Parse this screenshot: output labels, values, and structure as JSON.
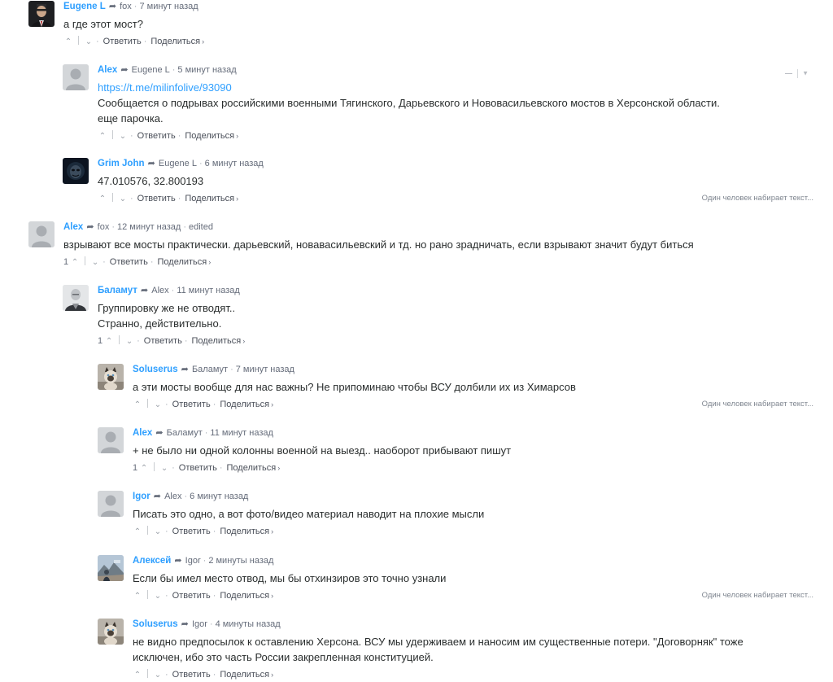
{
  "ui": {
    "reply_label": "Ответить",
    "share_label": "Поделиться",
    "share_chevron": "›",
    "typing_indicator": "Один человек набирает текст...",
    "edited_label": "edited"
  },
  "colors": {
    "link": "#2e9fff",
    "text": "#2a2e2e",
    "meta": "#656c7a"
  },
  "comments": [
    {
      "author": "Eugene L",
      "parent": "fox",
      "time": "7 минут назад",
      "text": "а где этот мост?",
      "votes": "",
      "avatar": "portrait-icon"
    },
    {
      "author": "Alex",
      "parent": "Eugene L",
      "time": "5 минут назад",
      "link": "https://t.me/milinfolive/93090",
      "text": "Сообщается о подрывах российскими военными Тягинского, Дарьевского и Нововасильевского мостов в Херсонской области.\nеще парочка.",
      "votes": "",
      "avatar": "default-avatar-icon"
    },
    {
      "author": "Grim John",
      "parent": "Eugene L",
      "time": "6 минут назад",
      "text": "47.010576, 32.800193",
      "votes": "",
      "avatar": "dark-mask-icon"
    },
    {
      "author": "Alex",
      "parent": "fox",
      "time": "12 минут назад",
      "edited": true,
      "text": "взрывают все мосты практически. дарьевский, новавасильевский и тд. но рано зрадничать, если взрывают значит будут биться",
      "votes": "1",
      "avatar": "default-avatar-icon"
    },
    {
      "author": "Баламут",
      "parent": "Alex",
      "time": "11 минут назад",
      "text": "Группировку же не отводят..\nСтранно, действительно.",
      "votes": "1",
      "avatar": "bald-man-icon"
    },
    {
      "author": "Soluserus",
      "parent": "Баламут",
      "time": "7 минут назад",
      "text": "а эти мосты вообще для нас важны? Не припоминаю чтобы ВСУ долбили их из Химарсов",
      "votes": "",
      "avatar": "cat-icon"
    },
    {
      "author": "Alex",
      "parent": "Баламут",
      "time": "11 минут назад",
      "text": "+ не было ни одной колонны военной на выезд.. наоборот прибывают пишут",
      "votes": "1",
      "avatar": "default-avatar-icon"
    },
    {
      "author": "Igor",
      "parent": "Alex",
      "time": "6 минут назад",
      "text": "Писать это одно, а вот фото/видео материал наводит на плохие мысли",
      "votes": "",
      "avatar": "default-avatar-icon"
    },
    {
      "author": "Алексей",
      "parent": "Igor",
      "time": "2 минуты назад",
      "text": "Если бы имел место отвод, мы бы отхинзиров это точно узнали",
      "votes": "",
      "avatar": "mountain-photo-icon"
    },
    {
      "author": "Soluserus",
      "parent": "Igor",
      "time": "4 минуты назад",
      "text": "не видно предпосылок к оставлению Херсона. ВСУ мы удерживаем и наносим им существенные потери. \"Договорняк\" тоже\nисключен, ибо это часть России закрепленная конституцией.",
      "votes": "",
      "avatar": "cat-icon"
    }
  ]
}
